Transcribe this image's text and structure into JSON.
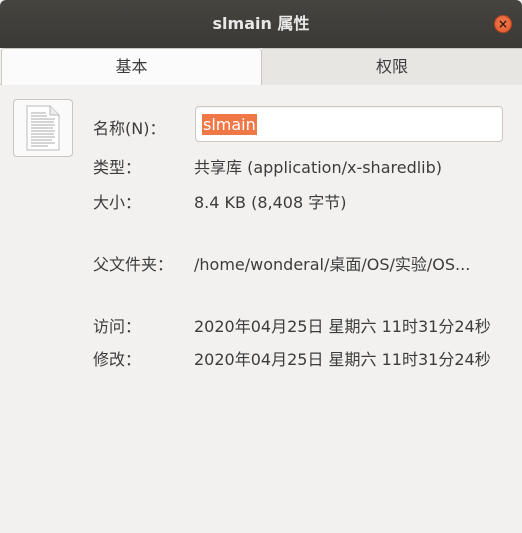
{
  "window": {
    "title": "slmain 属性",
    "close_glyph": "×"
  },
  "tabs": [
    {
      "label": "基本",
      "active": true
    },
    {
      "label": "权限",
      "active": false
    }
  ],
  "file_icon": "text-document-icon",
  "colors": {
    "accent_selection": "#f07746",
    "titlebar": "#3a3935",
    "close_button": "#e05a2c"
  },
  "fields": {
    "name": {
      "label": "名称(N)：",
      "value": "slmain"
    },
    "type": {
      "label": "类型：",
      "value": "共享库 (application/x-sharedlib)"
    },
    "size": {
      "label": "大小：",
      "value": "8.4 KB (8,408 字节)"
    },
    "parent": {
      "label": "父文件夹：",
      "value": "/home/wonderal/桌面/OS/实验/OS..."
    },
    "accessed": {
      "label": "访问：",
      "value": "2020年04月25日 星期六 11时31分24秒"
    },
    "modified": {
      "label": "修改：",
      "value": "2020年04月25日 星期六 11时31分24秒"
    }
  }
}
